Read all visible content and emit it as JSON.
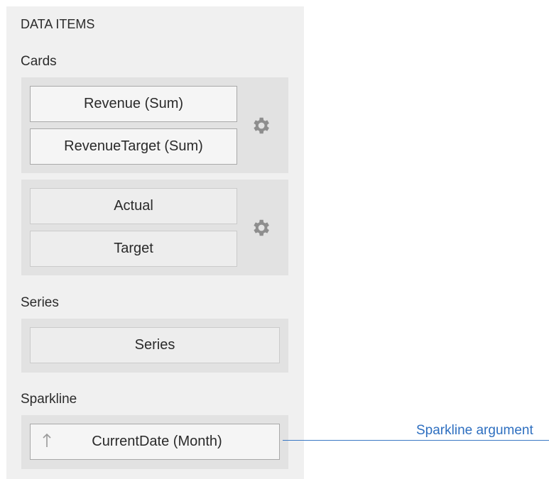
{
  "panel": {
    "header": "DATA ITEMS",
    "cards_label": "Cards",
    "cards": [
      {
        "actual": "Revenue (Sum)",
        "target": "RevenueTarget (Sum)"
      },
      {
        "actual": "Actual",
        "target": "Target"
      }
    ],
    "series_label": "Series",
    "series_placeholder": "Series",
    "sparkline_label": "Sparkline",
    "sparkline_field": "CurrentDate (Month)"
  },
  "annotation": {
    "text": "Sparkline argument",
    "color": "#2e6fc0"
  },
  "icons": {
    "options": "gear-icon",
    "sort": "sort-ascending-icon"
  }
}
